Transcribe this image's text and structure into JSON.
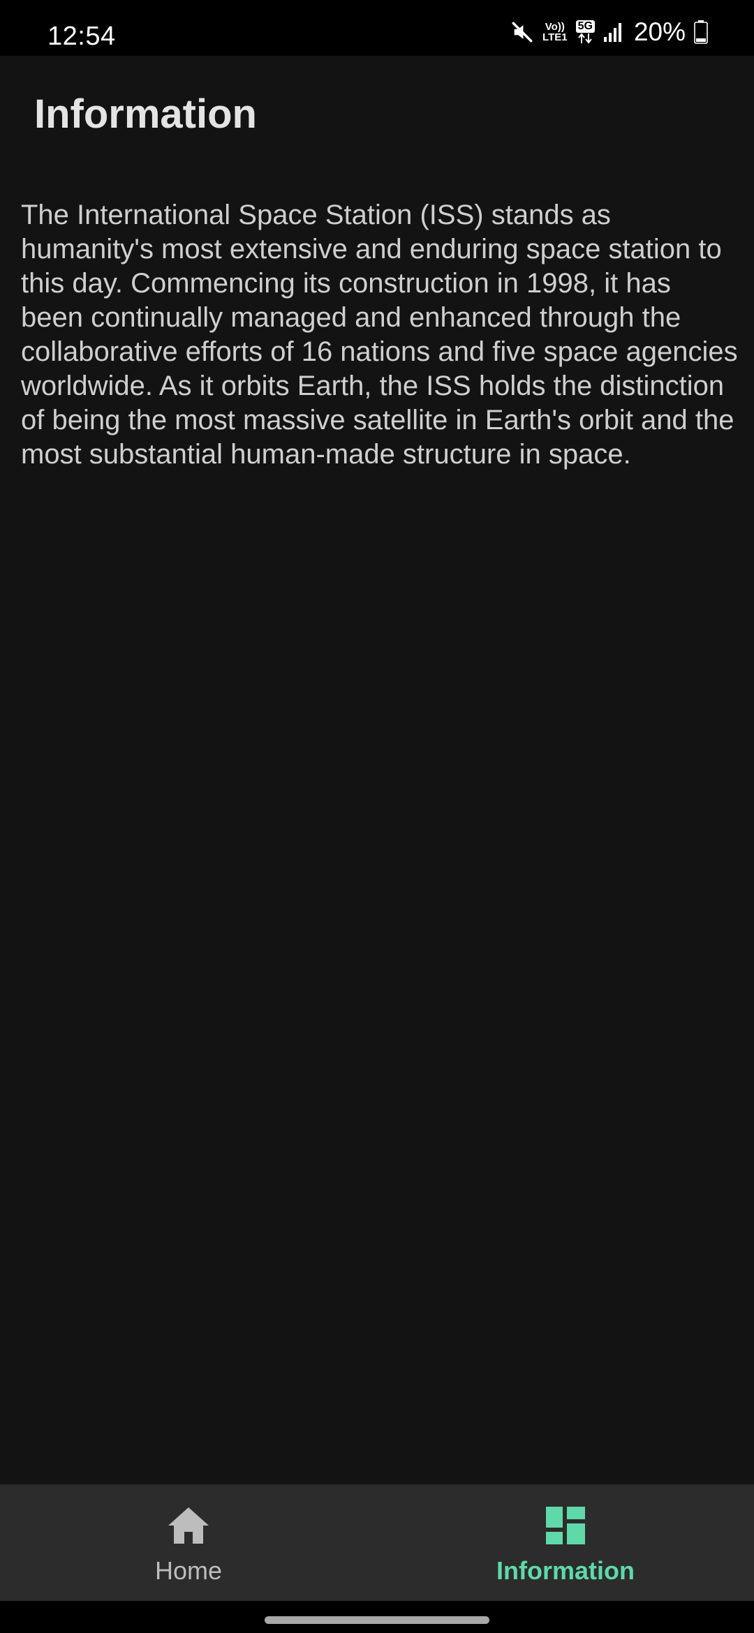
{
  "status_bar": {
    "time": "12:54",
    "volte_top": "Vo))",
    "volte_bottom": "LTE1",
    "network_badge": "5G",
    "battery_percent": "20%",
    "icons": [
      "mute-icon",
      "volte-icon",
      "5g-data-icon",
      "signal-icon",
      "battery-icon"
    ],
    "battery_level": 0.2
  },
  "header": {
    "title": "Information"
  },
  "content": {
    "paragraph": "The International Space Station (ISS) stands as humanity's most extensive and enduring space station to this day. Commencing its construction in 1998, it has been continually managed and enhanced through the collaborative efforts of 16 nations and five space agencies worldwide. As it orbits Earth, the ISS holds the distinction of being the most massive satellite in Earth's orbit and the most substantial human-made structure in space."
  },
  "bottom_nav": {
    "items": [
      {
        "label": "Home",
        "icon": "home-icon",
        "selected": false
      },
      {
        "label": "Information",
        "icon": "dashboard-icon",
        "selected": true
      }
    ]
  },
  "colors": {
    "background": "#131313",
    "nav_background": "#2c2c2c",
    "accent": "#5fd9a9",
    "title_text": "#e4e4e4",
    "body_text": "#cfcfcf",
    "inactive_nav": "#bdbdbd"
  }
}
